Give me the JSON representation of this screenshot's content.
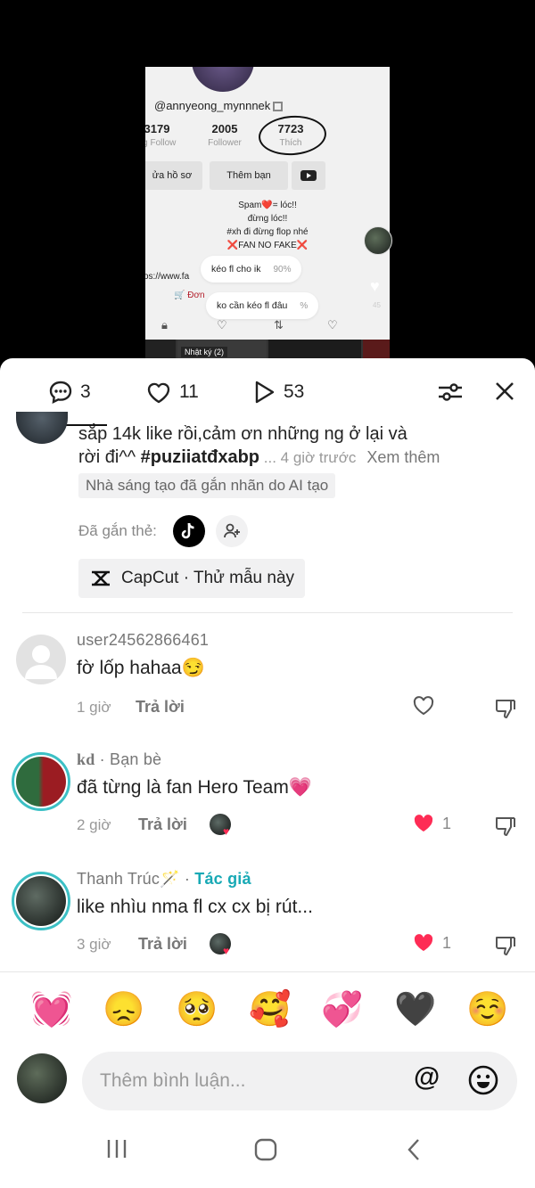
{
  "preview": {
    "username": "@annyeong_mynnnek",
    "stats": [
      {
        "value": "3179",
        "label": "ng Follow"
      },
      {
        "value": "2005",
        "label": "Follower"
      },
      {
        "value": "7723",
        "label": "Thích"
      }
    ],
    "edit_profile": "ửa hồ sơ",
    "add_friend": "Thêm bạn",
    "bio_lines": [
      "Spam❤️= lóc!!",
      "đừng lóc!!",
      "#xh đi đừng flop nhé",
      "❌FAN NO FAKE❌"
    ],
    "link": "os://www.fa",
    "order": "🛒 Đơn",
    "bubble1": {
      "text": "kéo fl cho ik",
      "pct": "90%"
    },
    "bubble2": {
      "text": "ko cần kéo fl đâu",
      "pct": "%"
    },
    "diary": "Nhật ký (2)",
    "side_count": "45"
  },
  "tabs": {
    "comments": "3",
    "likes": "11",
    "views": "53"
  },
  "caption": {
    "line1": "sắp 14k like rồi,cảm ơn những ng ở lại và",
    "line2_prefix": "rời đi^^ ",
    "hashtag": "#puziiatđxabp",
    "meta": " ... 4 giờ trước",
    "more": "Xem thêm",
    "ai_label": "Nhà sáng tạo đã gắn nhãn do AI tạo",
    "tagged_label": "Đã gắn thẻ:",
    "capcut": "CapCut · Thử mẫu này"
  },
  "comments": [
    {
      "name": "user24562866461",
      "suffix": "",
      "author": "",
      "text": "fờ lốp hahaa😏",
      "time": "1 giờ",
      "reply": "Trả lời",
      "likes": ""
    },
    {
      "name": "kd",
      "suffix": " · Bạn bè",
      "author": "",
      "text": "đã từng là fan Hero Team💗",
      "time": "2 giờ",
      "reply": "Trả lời",
      "likes": "1"
    },
    {
      "name": "Thanh Trúc🪄",
      "suffix": " · ",
      "author": "Tác giả",
      "text": "like nhìu nma fl cx cx bị rút...",
      "time": "3 giờ",
      "reply": "Trả lời",
      "likes": "1"
    }
  ],
  "emojis": [
    "💓",
    "😞",
    "🥺",
    "🥰",
    "💞",
    "🖤",
    "☺️"
  ],
  "input": {
    "placeholder": "Thêm bình luận...",
    "at": "@"
  },
  "colors": {
    "like_red": "#fe2c55",
    "author_teal": "#18a9b5",
    "ring_teal": "#3cc0c5"
  }
}
